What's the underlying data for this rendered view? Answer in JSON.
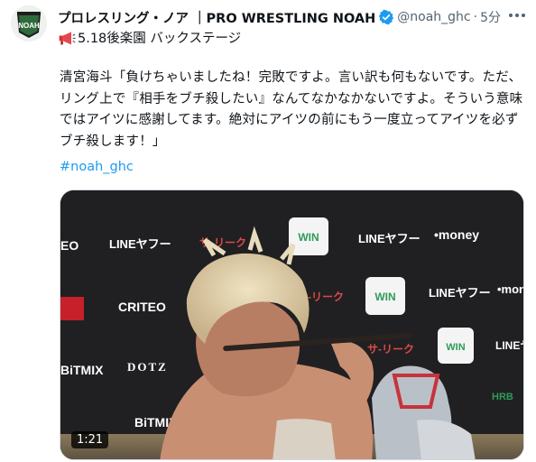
{
  "account": {
    "name": "プロレスリング・ノア ｜PRO WRESTLING NOAH",
    "handle": "@noah_ghc",
    "separator": "·",
    "time": "5分",
    "avatar_text": "NOAH"
  },
  "tweet": {
    "subline": "5.18後楽園 バックステージ",
    "body": "清宮海斗「負けちゃいましたね！完敗ですよ。言い訳も何もないです。ただ、リング上で『相手をブチ殺したい』なんてなかなかないですよ。そういう意味ではアイツに感謝してます。絶対にアイツの前にもう一度立ってアイツを必ずブチ殺します！」",
    "hashtag": "#noah_ghc"
  },
  "video": {
    "duration": "1:21",
    "sponsors": {
      "line": "LINEヤフー",
      "money": "•money",
      "win": "WIN",
      "criteo": "CRITEO",
      "dotz": "DOTZ",
      "bitmix": "BiTMIX",
      "sariku": "サ-リーク",
      "hrb": "HRB"
    }
  },
  "icons": [
    "verified-badge-icon",
    "more-icon",
    "megaphone-icon"
  ],
  "colors": {
    "accent": "#1d9bf0",
    "text": "#0f1419",
    "muted": "#536471"
  }
}
